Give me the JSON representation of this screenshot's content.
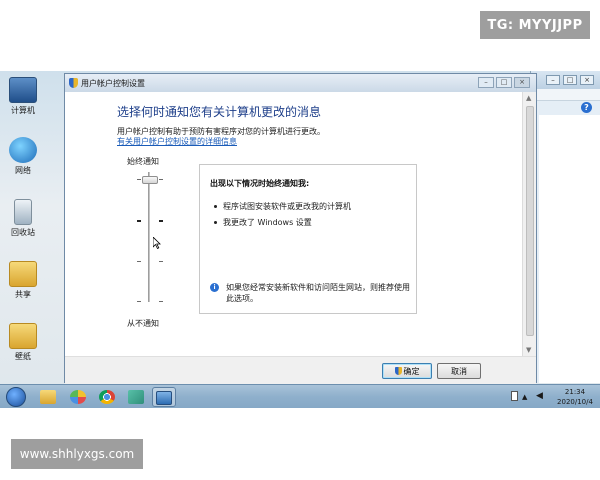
{
  "watermarks": {
    "top": "TG: MYYJJPP",
    "bottom": "www.shhlyxgs.com"
  },
  "desktop": {
    "icons": [
      {
        "label": "计算机"
      },
      {
        "label": "网络"
      },
      {
        "label": "回收站"
      },
      {
        "label": "共享"
      },
      {
        "label": "壁纸"
      }
    ]
  },
  "dialog": {
    "title": "用户帐户控制设置",
    "heading": "选择何时通知您有关计算机更改的消息",
    "description": "用户帐户控制有助于预防有害程序对您的计算机进行更改。",
    "link": "有关用户帐户控制设置的详细信息",
    "slider": {
      "top_label": "始终通知",
      "bottom_label": "从不通知",
      "level": 4,
      "levels": 4
    },
    "panel": {
      "heading": "出现以下情况时始终通知我:",
      "bullets": [
        "程序试图安装软件或更改我的计算机",
        "我更改了 Windows 设置"
      ],
      "info": "如果您经常安装新软件和访问陌生网站，则推荐使用此选项。"
    },
    "buttons": {
      "ok": "确定",
      "cancel": "取消"
    }
  },
  "taskbar": {
    "clock": {
      "time": "21:34",
      "date": "2020/10/4"
    }
  }
}
